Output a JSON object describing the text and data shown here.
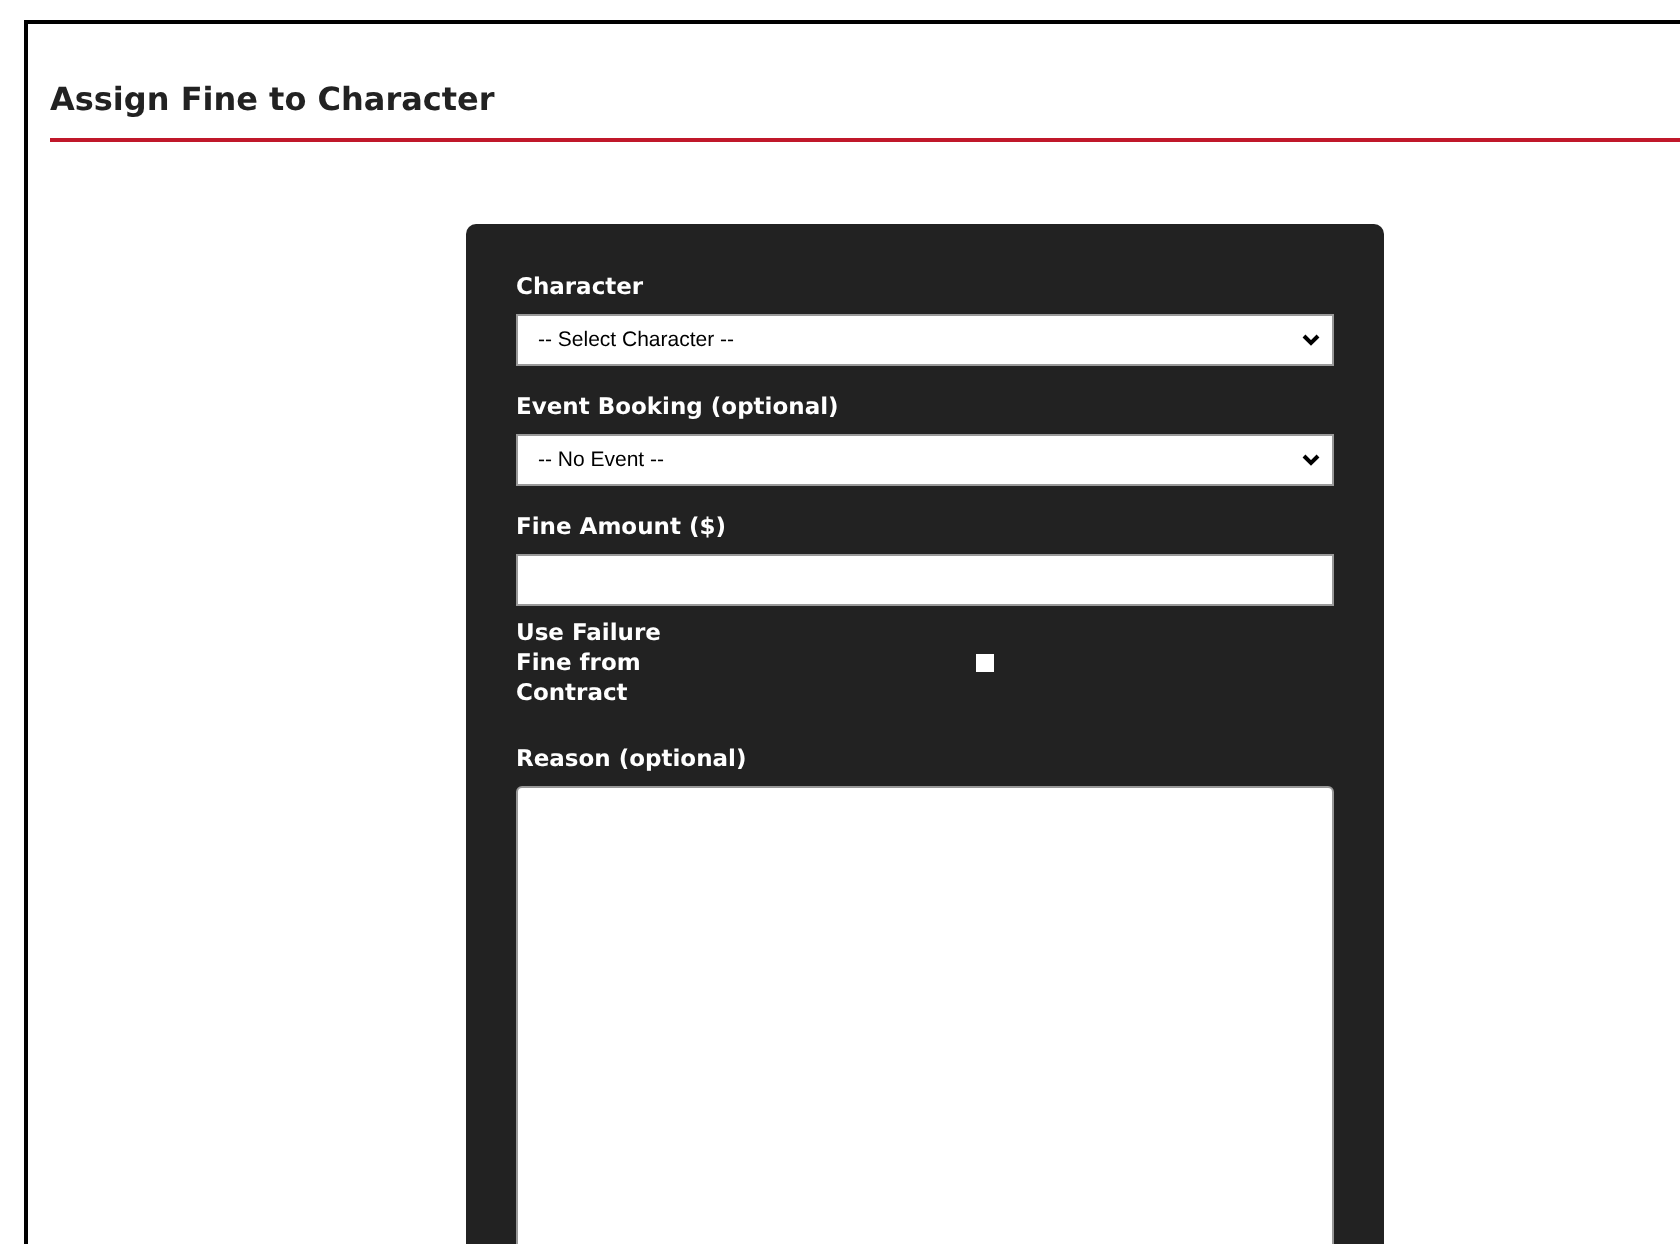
{
  "page": {
    "title": "Assign Fine to Character"
  },
  "form": {
    "fields": [
      {
        "kind": "select",
        "label": "Character",
        "value": "-- Select Character --"
      },
      {
        "kind": "select",
        "label": "Event Booking (optional)",
        "value": "-- No Event --"
      },
      {
        "kind": "text",
        "label": "Fine Amount ($)"
      },
      {
        "kind": "checkbox",
        "label": "Use Failure Fine from Contract",
        "checked": false
      },
      {
        "kind": "textarea",
        "label": "Reason (optional)"
      }
    ]
  }
}
